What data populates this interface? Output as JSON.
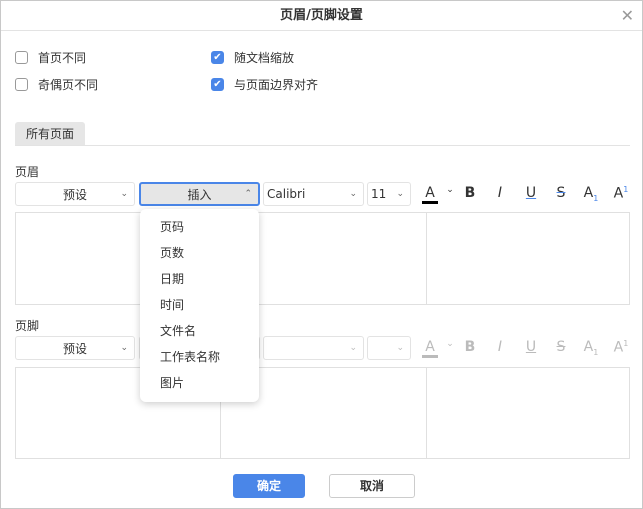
{
  "title": "页眉/页脚设置",
  "options": {
    "first_page_diff": {
      "label": "首页不同",
      "checked": false
    },
    "odd_even_diff": {
      "label": "奇偶页不同",
      "checked": false
    },
    "scale_with_doc": {
      "label": "随文档缩放",
      "checked": true
    },
    "align_with_margins": {
      "label": "与页面边界对齐",
      "checked": true
    }
  },
  "tab": "所有页面",
  "header": {
    "label": "页眉",
    "preset": "预设",
    "insert": "插入",
    "font": "Calibri",
    "size": "11"
  },
  "footer": {
    "label": "页脚",
    "preset": "预设"
  },
  "toolbar": {
    "font_color": "A",
    "bold": "B",
    "italic": "I",
    "underline": "U",
    "strike": "S",
    "subscript": "A",
    "superscript": "A",
    "sub_mark": "1",
    "sup_mark": "1"
  },
  "insert_menu": [
    "页码",
    "页数",
    "日期",
    "时间",
    "文件名",
    "工作表名称",
    "图片"
  ],
  "buttons": {
    "ok": "确定",
    "cancel": "取消"
  },
  "colors": {
    "accent": "#4a86e8"
  }
}
